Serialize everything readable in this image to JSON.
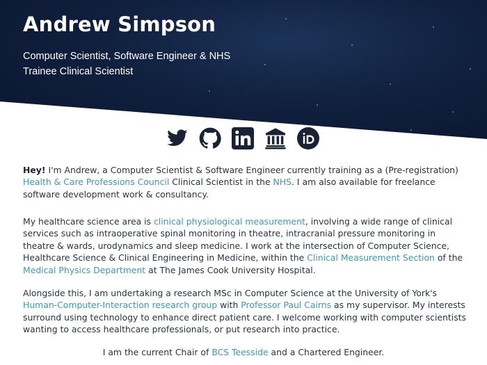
{
  "hero": {
    "name": "Andrew Simpson",
    "subtitle": "Computer Scientist, Software Engineer & NHS Trainee Clinical Scientist"
  },
  "social_icons": [
    "twitter-icon",
    "github-icon",
    "linkedin-icon",
    "institution-icon",
    "orcid-icon"
  ],
  "about": {
    "p1": {
      "greeting": "Hey!",
      "t1": " I'm Andrew, a Computer Scientist & Software Engineer currently training as a (Pre-registration) ",
      "link_hcpc": "Health & Care Professions Council",
      "t2": " Clinical Scientist in the ",
      "link_nhs": "NHS",
      "t3": ". I am also available for freelance software development work & consultancy."
    },
    "p2": {
      "t1": "My healthcare science area is ",
      "link_cpm": "clinical physiological measurement",
      "t2": ", involving a wide range of clinical services such as intraoperative spinal monitoring in theatre, intracranial pressure monitoring in theatre & wards, urodynamics and sleep medicine. I work at the intersection of Computer Science, Healthcare Science & Clinical Engineering in Medicine, within the ",
      "link_cms": "Clinical Measurement Section",
      "t3": " of the ",
      "link_mpd": "Medical Physics Department",
      "t4": " at The James Cook University Hospital."
    },
    "p3": {
      "t1": "Alongside this, I am undertaking a research MSc in Computer Science at the University of York's ",
      "link_hci": "Human-Computer-Interaction research group",
      "t2": " with ",
      "link_prof": "Professor Paul Cairns",
      "t3": " as my supervisor. My interests surround using technology to enhance direct patient care. I welcome working with computer scientists wanting to access healthcare professionals, or put research into practice."
    },
    "p4": {
      "t1": "I am the current Chair of ",
      "link_bcs": "BCS Teesside",
      "t2": " and a Chartered Engineer."
    }
  },
  "colors": {
    "hero_background": "#10203e",
    "link": "#3a9bb0",
    "icon": "#1a2238",
    "text": "#2b3246"
  }
}
